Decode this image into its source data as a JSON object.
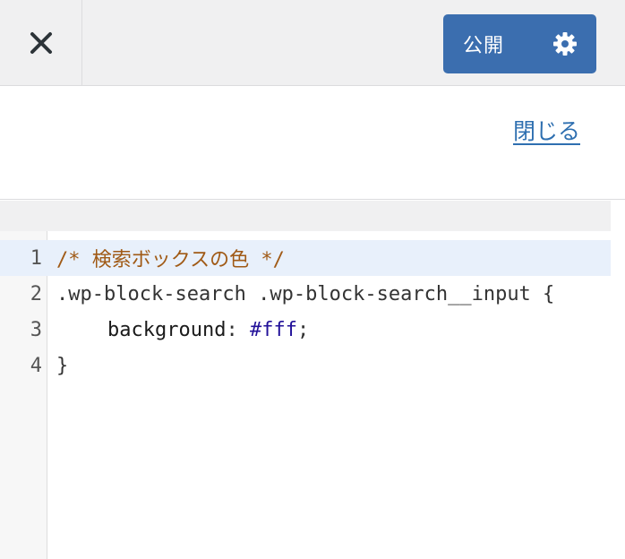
{
  "header": {
    "close_icon": "close-icon",
    "publish_label": "公開",
    "settings_icon": "gear-icon",
    "publish_color": "#3b6eaf"
  },
  "panel": {
    "close_link": "閉じる"
  },
  "editor": {
    "lines": [
      {
        "num": "1",
        "comment": "/* 検索ボックスの色 */"
      },
      {
        "num": "2",
        "code": ".wp-block-search .wp-block-search__input {"
      },
      {
        "num": "3",
        "prop": "background",
        "colon": ": ",
        "value": "#fff",
        "end": ";"
      },
      {
        "num": "4",
        "code": "}"
      }
    ]
  }
}
